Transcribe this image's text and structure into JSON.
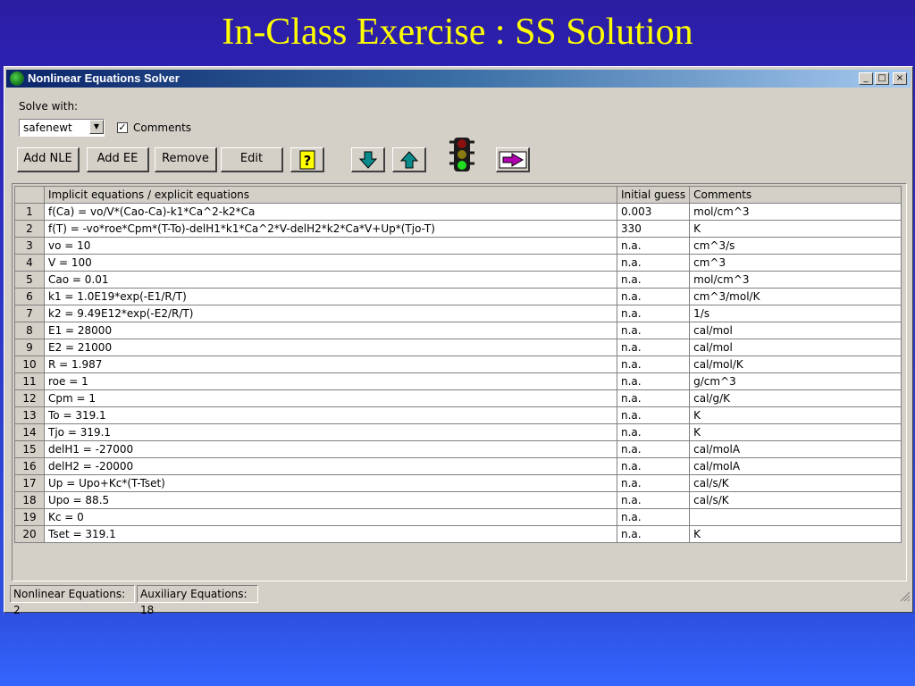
{
  "slide": {
    "title": "In-Class Exercise : SS Solution"
  },
  "window": {
    "title": "Nonlinear Equations Solver",
    "minimize": "_",
    "maximize": "□",
    "close": "×"
  },
  "solve": {
    "label": "Solve with:",
    "method": "safenewt",
    "comments_label": "Comments",
    "comments_checked": "✓"
  },
  "toolbar": {
    "add_nle": "Add NLE",
    "add_ee": "Add EE",
    "remove": "Remove",
    "edit": "Edit"
  },
  "table": {
    "headers": [
      "",
      "Implicit equations / explicit equations",
      "Initial guess",
      "Comments"
    ],
    "rows": [
      [
        "1",
        "f(Ca) = vo/V*(Cao-Ca)-k1*Ca^2-k2*Ca",
        "0.003",
        "mol/cm^3"
      ],
      [
        "2",
        "f(T) = -vo*roe*Cpm*(T-To)-delH1*k1*Ca^2*V-delH2*k2*Ca*V+Up*(Tjo-T)",
        "330",
        "K"
      ],
      [
        "3",
        "vo = 10",
        "n.a.",
        "cm^3/s"
      ],
      [
        "4",
        "V = 100",
        "n.a.",
        "cm^3"
      ],
      [
        "5",
        "Cao = 0.01",
        "n.a.",
        "mol/cm^3"
      ],
      [
        "6",
        "k1 = 1.0E19*exp(-E1/R/T)",
        "n.a.",
        "cm^3/mol/K"
      ],
      [
        "7",
        "k2 = 9.49E12*exp(-E2/R/T)",
        "n.a.",
        "1/s"
      ],
      [
        "8",
        "E1 = 28000",
        "n.a.",
        "cal/mol"
      ],
      [
        "9",
        "E2 = 21000",
        "n.a.",
        "cal/mol"
      ],
      [
        "10",
        "R = 1.987",
        "n.a.",
        "cal/mol/K"
      ],
      [
        "11",
        "roe = 1",
        "n.a.",
        "g/cm^3"
      ],
      [
        "12",
        "Cpm = 1",
        "n.a.",
        "cal/g/K"
      ],
      [
        "13",
        "To = 319.1",
        "n.a.",
        "K"
      ],
      [
        "14",
        "Tjo = 319.1",
        "n.a.",
        "K"
      ],
      [
        "15",
        "delH1 = -27000",
        "n.a.",
        "cal/molA"
      ],
      [
        "16",
        "delH2 = -20000",
        "n.a.",
        "cal/molA"
      ],
      [
        "17",
        "Up = Upo+Kc*(T-Tset)",
        "n.a.",
        "cal/s/K"
      ],
      [
        "18",
        "Upo = 88.5",
        "n.a.",
        "cal/s/K"
      ],
      [
        "19",
        "Kc = 0",
        "n.a.",
        ""
      ],
      [
        "20",
        "Tset = 319.1",
        "n.a.",
        "K"
      ]
    ]
  },
  "status": {
    "nonlinear": "Nonlinear Equations: 2",
    "auxiliary": "Auxiliary Equations: 18"
  },
  "colors": {
    "slide_bg": "#2c20b0",
    "title_text": "#ffff00",
    "titlebar_start": "#0a246a",
    "titlebar_end": "#a6caf0",
    "window_bg": "#d4d0c8"
  }
}
